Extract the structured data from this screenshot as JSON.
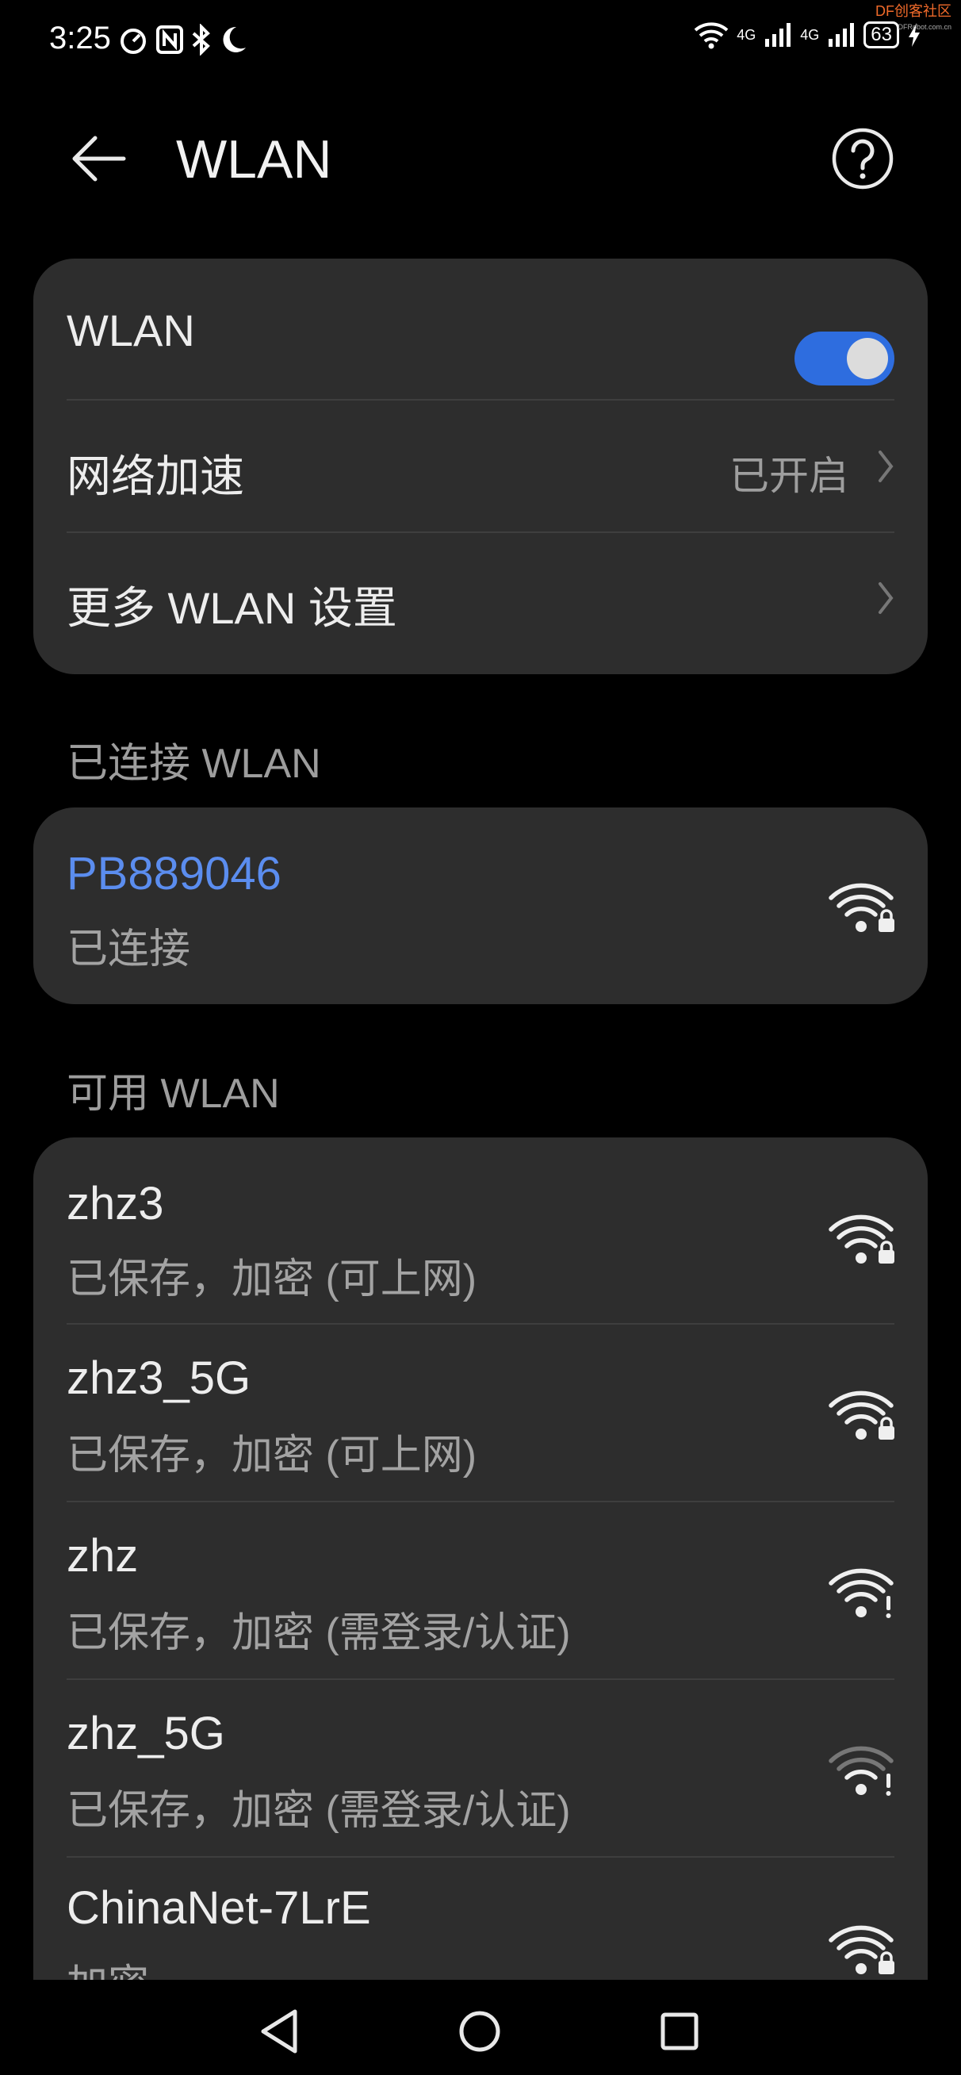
{
  "status_bar": {
    "time": "3:25",
    "network_type_1": "4G",
    "network_type_2": "4G",
    "battery": "63",
    "watermark": "DF创客社区",
    "watermark_sub": "DFRobot.com.cn"
  },
  "header": {
    "title": "WLAN"
  },
  "settings": {
    "wlan_label": "WLAN",
    "wlan_enabled": true,
    "accel_label": "网络加速",
    "accel_value": "已开启",
    "more_label": "更多 WLAN 设置"
  },
  "connected_section": {
    "label": "已连接 WLAN",
    "network": {
      "name": "PB889046",
      "status": "已连接",
      "signal": 4,
      "secured": true
    }
  },
  "available_section": {
    "label": "可用 WLAN",
    "networks": [
      {
        "name": "zhz3",
        "status": "已保存，加密 (可上网)",
        "signal": 4,
        "badge": "lock"
      },
      {
        "name": "zhz3_5G",
        "status": "已保存，加密 (可上网)",
        "signal": 4,
        "badge": "lock"
      },
      {
        "name": "zhz",
        "status": "已保存，加密 (需登录/认证)",
        "signal": 4,
        "badge": "alert"
      },
      {
        "name": "zhz_5G",
        "status": "已保存，加密 (需登录/认证)",
        "signal": 2,
        "badge": "alert"
      },
      {
        "name": "ChinaNet-7LrE",
        "status": "加密",
        "signal": 4,
        "badge": "lock"
      }
    ]
  },
  "colors": {
    "accent": "#2e6ddf",
    "connected_text": "#5b8def",
    "card": "#2d2d2d"
  },
  "icons": {
    "back": "back-arrow-icon",
    "help": "help-icon",
    "chevron": "chevron-right-icon",
    "wifi": "wifi-icon",
    "nav_back": "triangle-back-icon",
    "nav_home": "circle-home-icon",
    "nav_recent": "square-recent-icon"
  }
}
